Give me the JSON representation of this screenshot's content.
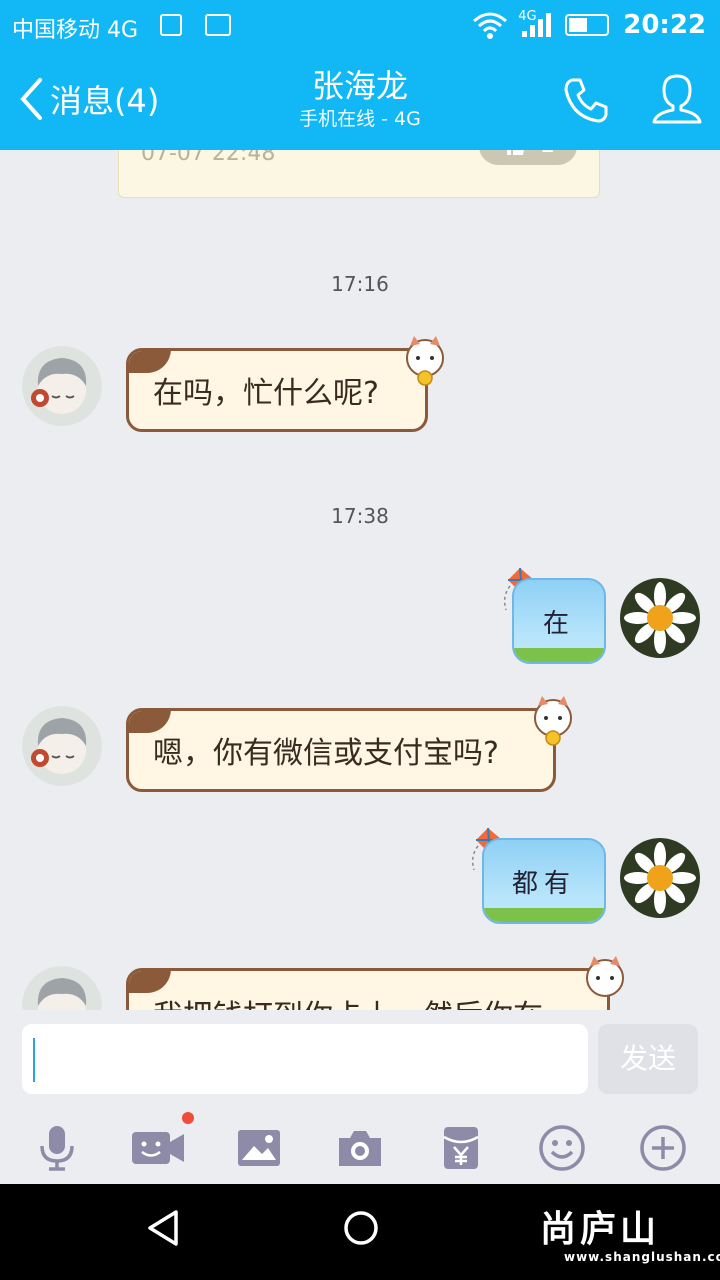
{
  "status_bar": {
    "carrier": "中国移动 4G",
    "network": "4G",
    "time": "20:22"
  },
  "header": {
    "back_label": "消息(4)",
    "contact_name": "张海龙",
    "contact_status": "手机在线 - 4G",
    "colors": {
      "header": "#12b7f5"
    }
  },
  "chat": {
    "previous_card": {
      "time": "07-07 22:48",
      "likes": "2"
    },
    "timestamps": [
      "17:16",
      "17:38"
    ],
    "messages": [
      {
        "side": "in",
        "text": "在吗，忙什么呢?"
      },
      {
        "side": "out",
        "text": "在"
      },
      {
        "side": "in",
        "text": "嗯，你有微信或支付宝吗?"
      },
      {
        "side": "out",
        "text": "都有"
      },
      {
        "side": "in",
        "text": "我把钱打到你卡上，然后你在"
      }
    ]
  },
  "input": {
    "placeholder": "",
    "send_label": "发送"
  },
  "toolbar": {
    "items": [
      "microphone-icon",
      "video-call-icon",
      "image-icon",
      "camera-icon",
      "red-packet-icon",
      "emoji-icon",
      "plus-icon"
    ]
  },
  "watermark": {
    "logo": "尚庐山",
    "url": "www.shanglushan.com"
  }
}
